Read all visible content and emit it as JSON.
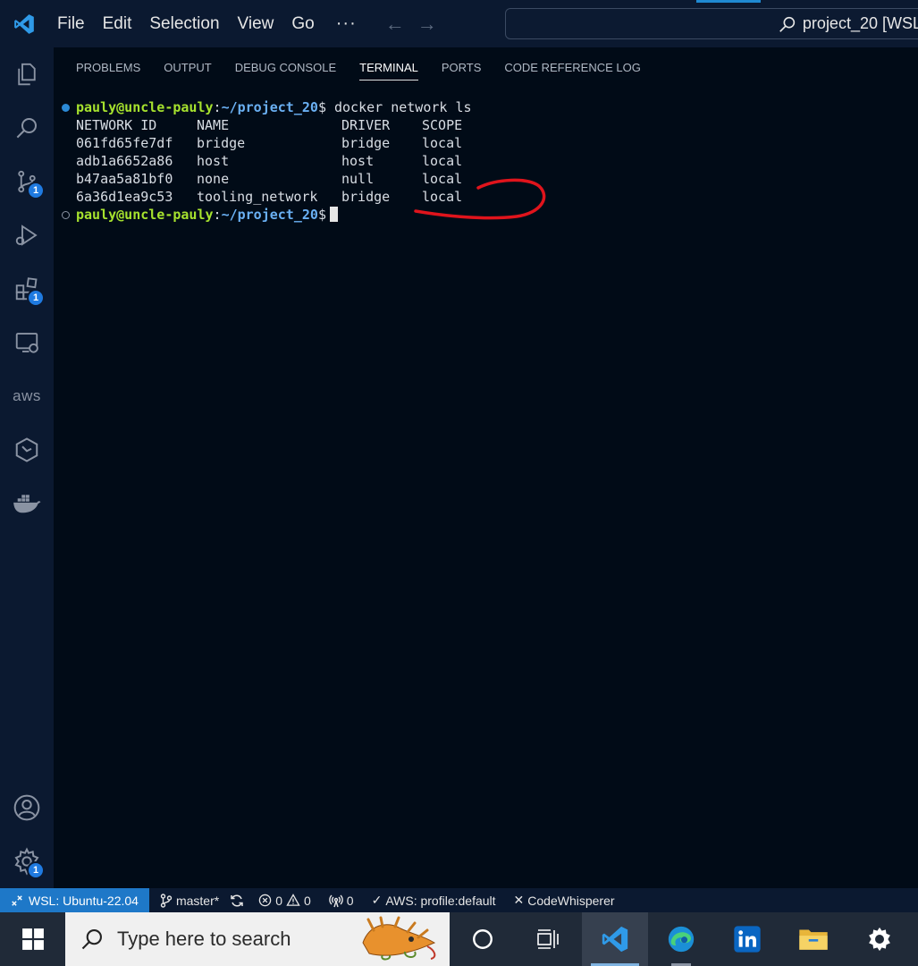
{
  "titlebar": {
    "menu": [
      "File",
      "Edit",
      "Selection",
      "View",
      "Go"
    ],
    "more": "···",
    "command_center": "project_20 [WSL:"
  },
  "activitybar": {
    "badges": {
      "source_control": "1",
      "extensions": "1",
      "settings": "1"
    },
    "aws_label": "aws"
  },
  "panel": {
    "tabs": [
      "PROBLEMS",
      "OUTPUT",
      "DEBUG CONSOLE",
      "TERMINAL",
      "PORTS",
      "CODE REFERENCE LOG"
    ],
    "active_tab": "TERMINAL"
  },
  "terminal": {
    "prompt_user": "pauly@uncle-pauly",
    "prompt_sep": ":",
    "prompt_path": "~/project_20",
    "prompt_end": "$",
    "command": " docker network ls",
    "headers": [
      "NETWORK ID",
      "NAME",
      "DRIVER",
      "SCOPE"
    ],
    "rows": [
      [
        "061fd65fe7df",
        "bridge",
        "bridge",
        "local"
      ],
      [
        "adb1a6652a86",
        "host",
        "host",
        "local"
      ],
      [
        "b47aa5a81bf0",
        "none",
        "null",
        "local"
      ],
      [
        "6a36d1ea9c53",
        "tooling_network",
        "bridge",
        "local"
      ]
    ]
  },
  "statusbar": {
    "remote": "WSL: Ubuntu-22.04",
    "branch": "master*",
    "errors": "0",
    "warnings": "0",
    "ports": "0",
    "aws": "AWS: profile:default",
    "codewhisperer": "CodeWhisperer"
  },
  "taskbar": {
    "search_placeholder": "Type here to search"
  },
  "colors": {
    "terminal_bg": "#010b17",
    "chrome_bg": "#0b1930",
    "prompt_user": "#a6e22e",
    "prompt_path": "#6ab0f3",
    "remote_bg": "#1e78c8",
    "annotation": "#e0141c"
  }
}
